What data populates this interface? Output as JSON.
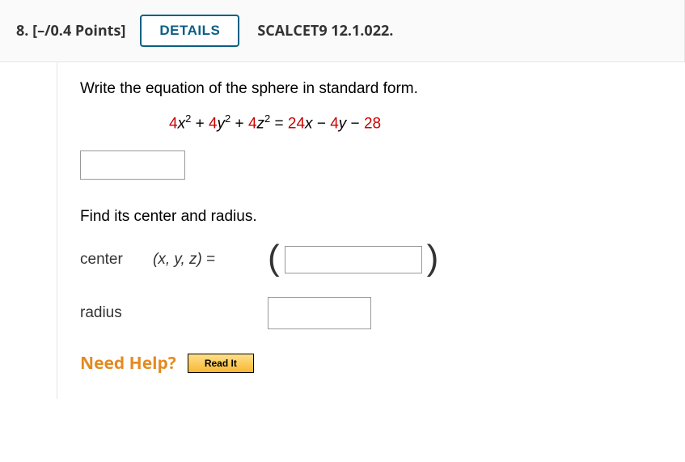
{
  "header": {
    "question_number": "8.",
    "points": "[–/0.4 Points]",
    "details_label": "DETAILS",
    "reference": "SCALCET9 12.1.022."
  },
  "problem": {
    "prompt1": "Write the equation of the sphere in standard form.",
    "equation_parts": {
      "a": "4",
      "x": "x",
      "sq1": "2",
      "plus1": " + ",
      "b": "4",
      "y": "y",
      "sq2": "2",
      "plus2": " + ",
      "c": "4",
      "z": "z",
      "sq3": "2",
      "eq": " = ",
      "r1": "24",
      "rx": "x",
      "minus1": " − ",
      "r2": "4",
      "ry": "y",
      "minus2": " − ",
      "r3": "28"
    },
    "prompt2": "Find its center and radius.",
    "center_label": "center",
    "xyz_label": "(x, y, z)",
    "equals": "  =",
    "radius_label": "radius"
  },
  "help": {
    "need_help": "Need Help?",
    "read_it": "Read It"
  }
}
